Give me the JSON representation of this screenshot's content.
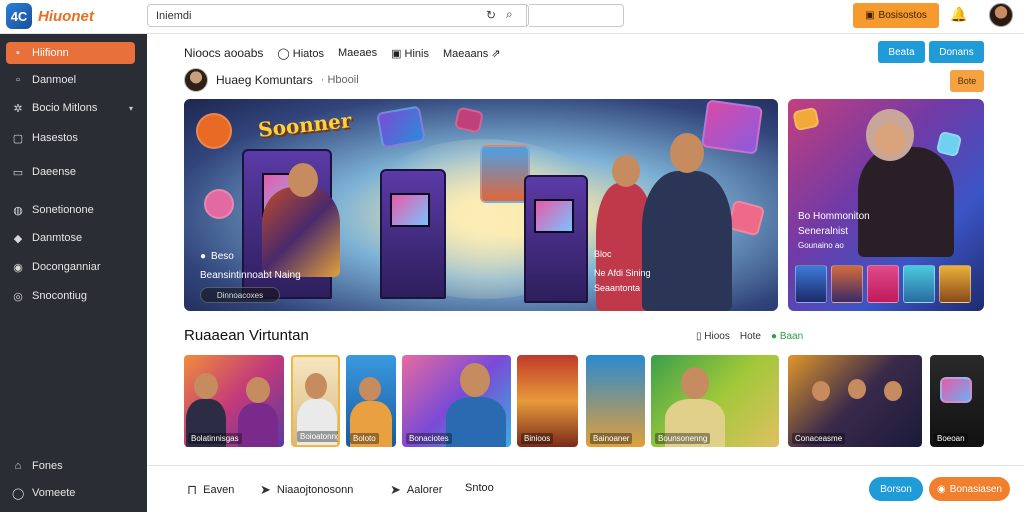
{
  "app": {
    "name": "Hiuonet",
    "logo_mark": "4C"
  },
  "search": {
    "value": "Iniemdi"
  },
  "topbar": {
    "cta_label": "Bosisostos",
    "bell_icon": "bell-icon",
    "accent": "#f59a2e"
  },
  "sidebar": {
    "items": [
      {
        "label": "Hiifionn",
        "icon": "image-icon",
        "active": true
      },
      {
        "label": "Danmoel",
        "icon": "square-icon"
      },
      {
        "label": "Bocio Mitlons",
        "icon": "users-icon",
        "caret": "▾"
      },
      {
        "label": "Hasestos",
        "icon": "frame-icon"
      },
      {
        "label": "Daeense",
        "icon": "chat-icon"
      },
      {
        "label": "Sonetionone",
        "icon": "globe-icon"
      },
      {
        "label": "Danmtose",
        "icon": "game-icon"
      },
      {
        "label": "Doconganniar",
        "icon": "camera-icon"
      },
      {
        "label": "Snocontiug",
        "icon": "pin-icon"
      },
      {
        "label": "Fones",
        "icon": "home-icon"
      },
      {
        "label": "Vomeete",
        "icon": "settings-icon"
      }
    ]
  },
  "subnav": {
    "items": [
      "Nioocs aooabs",
      "Hiatos",
      "Maeaes",
      "Hinis",
      "Maeaans"
    ],
    "btn1": "Beata",
    "btn2": "Donans",
    "small_btn": "Bote"
  },
  "room": {
    "title": "Huaeg Komuntars",
    "subtitle": "· Hbooil"
  },
  "hero": {
    "title": "Soonner",
    "tag1": "Beso",
    "line1": "Beansintinnoabt Naing",
    "pill": "Dinnoacoxes",
    "tag2": "Bloc",
    "line2": "Ne Afdi Sining",
    "line3": "Seaantonta"
  },
  "side_hero": {
    "line1": "Bo Hommoniton",
    "line2": "Seneralnist",
    "line3": "Gounaino ao"
  },
  "section": {
    "title": "Ruaaean Virtuntan",
    "links": [
      "Hioos",
      "Hote",
      "Baan"
    ]
  },
  "cards": [
    {
      "caption": "Bolatinnisgas"
    },
    {
      "caption": "Boioatonng"
    },
    {
      "caption": "Boloto"
    },
    {
      "caption": "Bonaciotes"
    },
    {
      "caption": "Binioos"
    },
    {
      "caption": "Bainoaner"
    },
    {
      "caption": "Bounsonenng"
    },
    {
      "caption": "Conaceasme"
    },
    {
      "caption": "Boeoan"
    }
  ],
  "bottom": {
    "items": [
      "Eaven",
      "Niaaojtonosonn",
      "Aalorer",
      "Sntoo"
    ],
    "pill_blue": "Borson",
    "pill_orange": "Bonasiasen"
  }
}
